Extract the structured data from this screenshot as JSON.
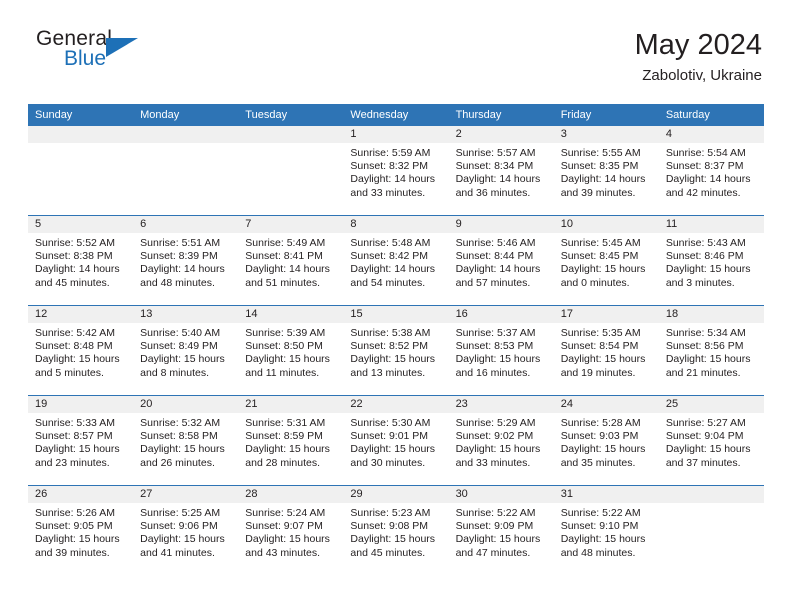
{
  "logo": {
    "word_one": "General",
    "word_two": "Blue",
    "triangle_icon": "triangle-icon"
  },
  "header": {
    "title": "May 2024",
    "subtitle": "Zabolotiv, Ukraine"
  },
  "colors": {
    "header_blue": "#2e74b5",
    "logo_blue": "#1d70b7",
    "daynum_band": "#f0f0f0",
    "text": "#231f20"
  },
  "weekday_headers": [
    "Sunday",
    "Monday",
    "Tuesday",
    "Wednesday",
    "Thursday",
    "Friday",
    "Saturday"
  ],
  "labels": {
    "sunrise_prefix": "Sunrise:",
    "sunset_prefix": "Sunset:",
    "daylight_prefix": "Daylight:"
  },
  "weeks": [
    [
      {
        "day": "",
        "empty": true
      },
      {
        "day": "",
        "empty": true
      },
      {
        "day": "",
        "empty": true
      },
      {
        "day": "1",
        "sunrise": "Sunrise: 5:59 AM",
        "sunset": "Sunset: 8:32 PM",
        "daylight_line1": "Daylight: 14 hours",
        "daylight_line2": "and 33 minutes."
      },
      {
        "day": "2",
        "sunrise": "Sunrise: 5:57 AM",
        "sunset": "Sunset: 8:34 PM",
        "daylight_line1": "Daylight: 14 hours",
        "daylight_line2": "and 36 minutes."
      },
      {
        "day": "3",
        "sunrise": "Sunrise: 5:55 AM",
        "sunset": "Sunset: 8:35 PM",
        "daylight_line1": "Daylight: 14 hours",
        "daylight_line2": "and 39 minutes."
      },
      {
        "day": "4",
        "sunrise": "Sunrise: 5:54 AM",
        "sunset": "Sunset: 8:37 PM",
        "daylight_line1": "Daylight: 14 hours",
        "daylight_line2": "and 42 minutes."
      }
    ],
    [
      {
        "day": "5",
        "sunrise": "Sunrise: 5:52 AM",
        "sunset": "Sunset: 8:38 PM",
        "daylight_line1": "Daylight: 14 hours",
        "daylight_line2": "and 45 minutes."
      },
      {
        "day": "6",
        "sunrise": "Sunrise: 5:51 AM",
        "sunset": "Sunset: 8:39 PM",
        "daylight_line1": "Daylight: 14 hours",
        "daylight_line2": "and 48 minutes."
      },
      {
        "day": "7",
        "sunrise": "Sunrise: 5:49 AM",
        "sunset": "Sunset: 8:41 PM",
        "daylight_line1": "Daylight: 14 hours",
        "daylight_line2": "and 51 minutes."
      },
      {
        "day": "8",
        "sunrise": "Sunrise: 5:48 AM",
        "sunset": "Sunset: 8:42 PM",
        "daylight_line1": "Daylight: 14 hours",
        "daylight_line2": "and 54 minutes."
      },
      {
        "day": "9",
        "sunrise": "Sunrise: 5:46 AM",
        "sunset": "Sunset: 8:44 PM",
        "daylight_line1": "Daylight: 14 hours",
        "daylight_line2": "and 57 minutes."
      },
      {
        "day": "10",
        "sunrise": "Sunrise: 5:45 AM",
        "sunset": "Sunset: 8:45 PM",
        "daylight_line1": "Daylight: 15 hours",
        "daylight_line2": "and 0 minutes."
      },
      {
        "day": "11",
        "sunrise": "Sunrise: 5:43 AM",
        "sunset": "Sunset: 8:46 PM",
        "daylight_line1": "Daylight: 15 hours",
        "daylight_line2": "and 3 minutes."
      }
    ],
    [
      {
        "day": "12",
        "sunrise": "Sunrise: 5:42 AM",
        "sunset": "Sunset: 8:48 PM",
        "daylight_line1": "Daylight: 15 hours",
        "daylight_line2": "and 5 minutes."
      },
      {
        "day": "13",
        "sunrise": "Sunrise: 5:40 AM",
        "sunset": "Sunset: 8:49 PM",
        "daylight_line1": "Daylight: 15 hours",
        "daylight_line2": "and 8 minutes."
      },
      {
        "day": "14",
        "sunrise": "Sunrise: 5:39 AM",
        "sunset": "Sunset: 8:50 PM",
        "daylight_line1": "Daylight: 15 hours",
        "daylight_line2": "and 11 minutes."
      },
      {
        "day": "15",
        "sunrise": "Sunrise: 5:38 AM",
        "sunset": "Sunset: 8:52 PM",
        "daylight_line1": "Daylight: 15 hours",
        "daylight_line2": "and 13 minutes."
      },
      {
        "day": "16",
        "sunrise": "Sunrise: 5:37 AM",
        "sunset": "Sunset: 8:53 PM",
        "daylight_line1": "Daylight: 15 hours",
        "daylight_line2": "and 16 minutes."
      },
      {
        "day": "17",
        "sunrise": "Sunrise: 5:35 AM",
        "sunset": "Sunset: 8:54 PM",
        "daylight_line1": "Daylight: 15 hours",
        "daylight_line2": "and 19 minutes."
      },
      {
        "day": "18",
        "sunrise": "Sunrise: 5:34 AM",
        "sunset": "Sunset: 8:56 PM",
        "daylight_line1": "Daylight: 15 hours",
        "daylight_line2": "and 21 minutes."
      }
    ],
    [
      {
        "day": "19",
        "sunrise": "Sunrise: 5:33 AM",
        "sunset": "Sunset: 8:57 PM",
        "daylight_line1": "Daylight: 15 hours",
        "daylight_line2": "and 23 minutes."
      },
      {
        "day": "20",
        "sunrise": "Sunrise: 5:32 AM",
        "sunset": "Sunset: 8:58 PM",
        "daylight_line1": "Daylight: 15 hours",
        "daylight_line2": "and 26 minutes."
      },
      {
        "day": "21",
        "sunrise": "Sunrise: 5:31 AM",
        "sunset": "Sunset: 8:59 PM",
        "daylight_line1": "Daylight: 15 hours",
        "daylight_line2": "and 28 minutes."
      },
      {
        "day": "22",
        "sunrise": "Sunrise: 5:30 AM",
        "sunset": "Sunset: 9:01 PM",
        "daylight_line1": "Daylight: 15 hours",
        "daylight_line2": "and 30 minutes."
      },
      {
        "day": "23",
        "sunrise": "Sunrise: 5:29 AM",
        "sunset": "Sunset: 9:02 PM",
        "daylight_line1": "Daylight: 15 hours",
        "daylight_line2": "and 33 minutes."
      },
      {
        "day": "24",
        "sunrise": "Sunrise: 5:28 AM",
        "sunset": "Sunset: 9:03 PM",
        "daylight_line1": "Daylight: 15 hours",
        "daylight_line2": "and 35 minutes."
      },
      {
        "day": "25",
        "sunrise": "Sunrise: 5:27 AM",
        "sunset": "Sunset: 9:04 PM",
        "daylight_line1": "Daylight: 15 hours",
        "daylight_line2": "and 37 minutes."
      }
    ],
    [
      {
        "day": "26",
        "sunrise": "Sunrise: 5:26 AM",
        "sunset": "Sunset: 9:05 PM",
        "daylight_line1": "Daylight: 15 hours",
        "daylight_line2": "and 39 minutes."
      },
      {
        "day": "27",
        "sunrise": "Sunrise: 5:25 AM",
        "sunset": "Sunset: 9:06 PM",
        "daylight_line1": "Daylight: 15 hours",
        "daylight_line2": "and 41 minutes."
      },
      {
        "day": "28",
        "sunrise": "Sunrise: 5:24 AM",
        "sunset": "Sunset: 9:07 PM",
        "daylight_line1": "Daylight: 15 hours",
        "daylight_line2": "and 43 minutes."
      },
      {
        "day": "29",
        "sunrise": "Sunrise: 5:23 AM",
        "sunset": "Sunset: 9:08 PM",
        "daylight_line1": "Daylight: 15 hours",
        "daylight_line2": "and 45 minutes."
      },
      {
        "day": "30",
        "sunrise": "Sunrise: 5:22 AM",
        "sunset": "Sunset: 9:09 PM",
        "daylight_line1": "Daylight: 15 hours",
        "daylight_line2": "and 47 minutes."
      },
      {
        "day": "31",
        "sunrise": "Sunrise: 5:22 AM",
        "sunset": "Sunset: 9:10 PM",
        "daylight_line1": "Daylight: 15 hours",
        "daylight_line2": "and 48 minutes."
      },
      {
        "day": "",
        "empty": true
      }
    ]
  ]
}
